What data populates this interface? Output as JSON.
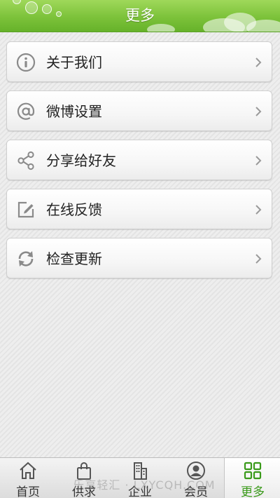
{
  "header": {
    "title": "更多"
  },
  "menu": {
    "items": [
      {
        "label": "关于我们",
        "icon": "info-icon"
      },
      {
        "label": "微博设置",
        "icon": "at-icon"
      },
      {
        "label": "分享给好友",
        "icon": "share-icon"
      },
      {
        "label": "在线反馈",
        "icon": "edit-icon"
      },
      {
        "label": "检查更新",
        "icon": "refresh-icon"
      }
    ]
  },
  "tabbar": {
    "tabs": [
      {
        "label": "首页",
        "icon": "home-icon"
      },
      {
        "label": "供求",
        "icon": "shopping-bag-icon"
      },
      {
        "label": "企业",
        "icon": "building-icon"
      },
      {
        "label": "会员",
        "icon": "user-icon"
      },
      {
        "label": "更多",
        "icon": "grid-icon",
        "active": true
      }
    ]
  },
  "watermark": "乐享轻汇 · LXYCQH.COM",
  "colors": {
    "header_green": "#7cc23a",
    "active_tab_green": "#3a9a1a",
    "icon_gray": "#8a8a8a"
  }
}
